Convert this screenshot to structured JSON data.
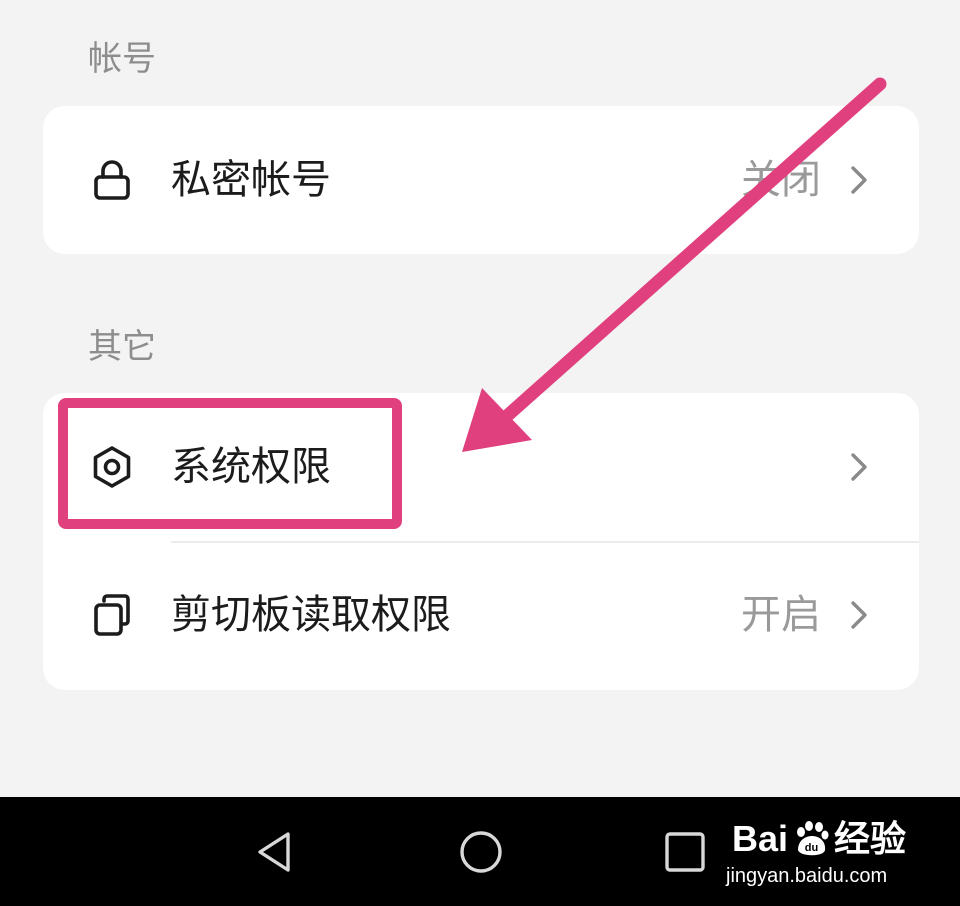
{
  "sections": [
    {
      "title": "帐号",
      "items": [
        {
          "label": "私密帐号",
          "value": "关闭",
          "icon": "lock-icon"
        }
      ]
    },
    {
      "title": "其它",
      "items": [
        {
          "label": "系统权限",
          "value": "",
          "icon": "hexagon-settings-icon"
        },
        {
          "label": "剪切板读取权限",
          "value": "开启",
          "icon": "clipboard-copy-icon"
        }
      ]
    }
  ],
  "navbar": {
    "buttons": [
      "back-icon",
      "home-icon",
      "recents-icon"
    ]
  },
  "watermark": {
    "brand_left": "Bai",
    "brand_du": "du",
    "brand_right": "经验",
    "url": "jingyan.baidu.com"
  },
  "colors": {
    "background": "#f3f3f3",
    "card": "#ffffff",
    "annotation": "#e0407e",
    "navbar": "#000000"
  }
}
